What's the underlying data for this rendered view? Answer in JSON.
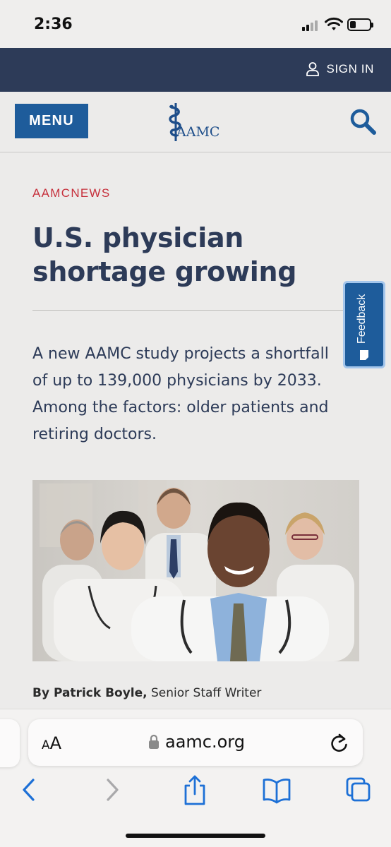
{
  "status_bar": {
    "time": "2:36",
    "battery_level": 0.3
  },
  "top_band": {
    "sign_in_label": "SIGN IN",
    "icon": "user-icon"
  },
  "header": {
    "menu_label": "MENU",
    "logo_text": "AAMC",
    "search_icon": "search-icon"
  },
  "article": {
    "kicker": "AAMCNEWS",
    "headline": "U.S. physician shortage growing",
    "dek_lines": [
      "A new AAMC study projects a shortfall",
      "of up to 139,000 physicians by 2033.",
      "Among the factors: older patients and",
      "retiring doctors."
    ],
    "byline_author": "By Patrick Boyle,",
    "byline_role": " Senior Staff Writer"
  },
  "feedback": {
    "label": "Feedback"
  },
  "browser": {
    "text_size_small": "A",
    "text_size_big": "A",
    "url": "aamc.org",
    "icons": [
      "back-icon",
      "forward-icon",
      "share-icon",
      "bookmarks-icon",
      "tabs-icon",
      "lock-icon",
      "reload-icon"
    ]
  },
  "colors": {
    "navy": "#2d3b58",
    "blue": "#1e5c9b",
    "accent_red": "#c6303c"
  }
}
